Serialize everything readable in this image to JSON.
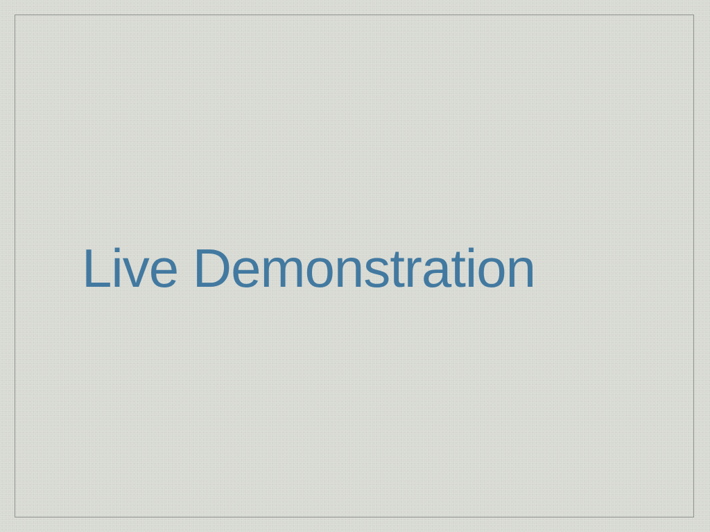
{
  "slide": {
    "title": "Live Demonstration"
  },
  "colors": {
    "background": "#d7d9d2",
    "frame": "#8e918d",
    "title": "#4279a0"
  }
}
